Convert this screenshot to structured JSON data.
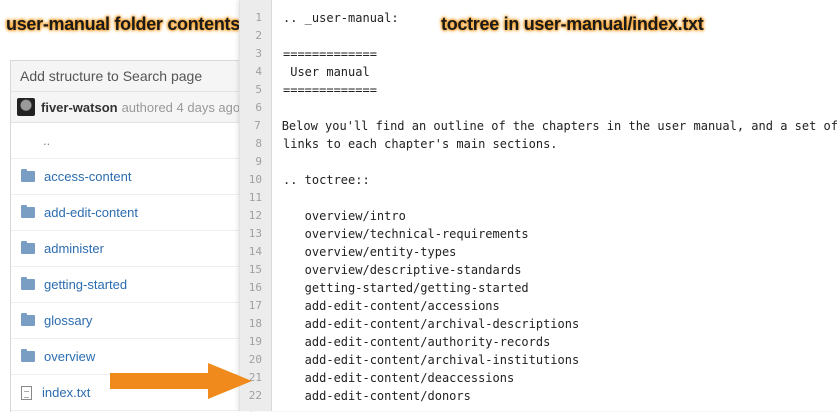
{
  "captions": {
    "left": "user-manual folder contents",
    "right": "toctree in user-manual/index.txt"
  },
  "left_panel": {
    "header": "Add structure to Search page",
    "commit": {
      "author": "fiver-watson",
      "meta": "authored 4 days ago"
    },
    "parent_dir": "..",
    "folders": [
      "access-content",
      "add-edit-content",
      "administer",
      "getting-started",
      "glossary",
      "overview"
    ],
    "file": "index.txt"
  },
  "code": {
    "lines": [
      {
        "n": "1",
        "t": ".. _user-manual:"
      },
      {
        "n": "2",
        "t": ""
      },
      {
        "n": "3",
        "t": "============="
      },
      {
        "n": "4",
        "t": " User manual"
      },
      {
        "n": "5",
        "t": "============="
      },
      {
        "n": "6",
        "t": ""
      },
      {
        "n": "7",
        "t": "Below you'll find an outline of the chapters in the user manual, and a set of"
      },
      {
        "n": "8",
        "t": "links to each chapter's main sections."
      },
      {
        "n": "9",
        "t": ""
      },
      {
        "n": "10",
        "t": ".. toctree::"
      },
      {
        "n": "11",
        "t": ""
      },
      {
        "n": "12",
        "t": "   overview/intro"
      },
      {
        "n": "13",
        "t": "   overview/technical-requirements"
      },
      {
        "n": "14",
        "t": "   overview/entity-types"
      },
      {
        "n": "15",
        "t": "   overview/descriptive-standards"
      },
      {
        "n": "16",
        "t": "   getting-started/getting-started"
      },
      {
        "n": "17",
        "t": "   add-edit-content/accessions"
      },
      {
        "n": "18",
        "t": "   add-edit-content/archival-descriptions"
      },
      {
        "n": "19",
        "t": "   add-edit-content/authority-records"
      },
      {
        "n": "20",
        "t": "   add-edit-content/archival-institutions"
      },
      {
        "n": "21",
        "t": "   add-edit-content/deaccessions"
      },
      {
        "n": "22",
        "t": "   add-edit-content/donors"
      }
    ]
  },
  "colors": {
    "accent_arrow": "#f08a1c",
    "link": "#2b6cb0",
    "folder": "#7a9ec3"
  }
}
